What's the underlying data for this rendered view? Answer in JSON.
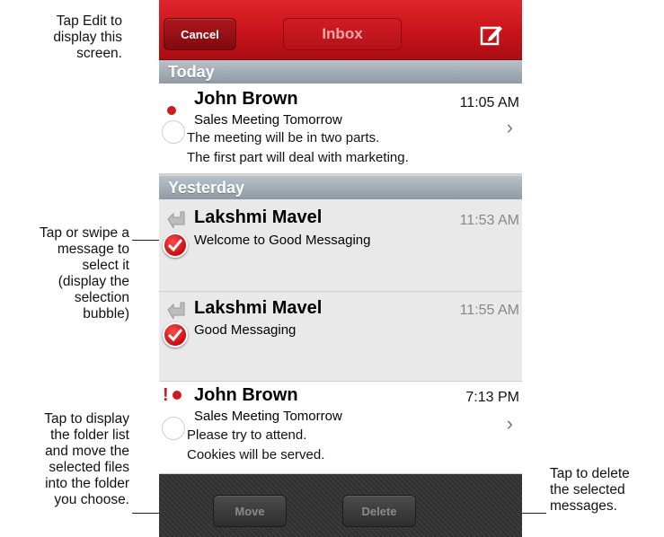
{
  "callouts": {
    "edit": [
      "Tap Edit to",
      "display this",
      "screen."
    ],
    "select": [
      "Tap or swipe a",
      "message to",
      "select it",
      "(display the",
      "selection",
      "bubble)"
    ],
    "move": [
      "Tap to display",
      "the folder list",
      "and move the",
      "selected files",
      "into the folder",
      "you choose."
    ],
    "delete": [
      "Tap to delete",
      "the selected",
      "messages."
    ]
  },
  "navbar": {
    "cancel_label": "Cancel",
    "title": "Inbox",
    "compose_icon": "compose-icon"
  },
  "sections": {
    "today": "Today",
    "yesterday": "Yesterday"
  },
  "messages": [
    {
      "sender": "John Brown",
      "subject": "Sales Meeting Tomorrow",
      "preview_line1": "The meeting will be in two parts.",
      "preview_line2": "The first part will deal with marketing.",
      "time": "11:05 AM",
      "unread": true,
      "selected": false,
      "replied": false,
      "urgent": false
    },
    {
      "sender": "Lakshmi Mavel",
      "subject": "Welcome to Good Messaging",
      "time": "11:53 AM",
      "unread": false,
      "selected": true,
      "replied": true,
      "urgent": false
    },
    {
      "sender": "Lakshmi Mavel",
      "subject": "Good Messaging",
      "time": "11:55 AM",
      "unread": false,
      "selected": true,
      "replied": true,
      "urgent": false
    },
    {
      "sender": "John Brown",
      "subject": "Sales Meeting Tomorrow",
      "preview_line1": "Please try to attend.",
      "preview_line2": "Cookies will be served.",
      "time": "7:13 PM",
      "unread": true,
      "selected": false,
      "replied": false,
      "urgent": true,
      "urgent_mark": "!"
    }
  ],
  "toolbar": {
    "move_label": "Move",
    "delete_label": "Delete"
  },
  "colors": {
    "navbar_red": "#c8131a",
    "selection_red": "#cf1a22",
    "toolbar_dark": "#333333"
  }
}
